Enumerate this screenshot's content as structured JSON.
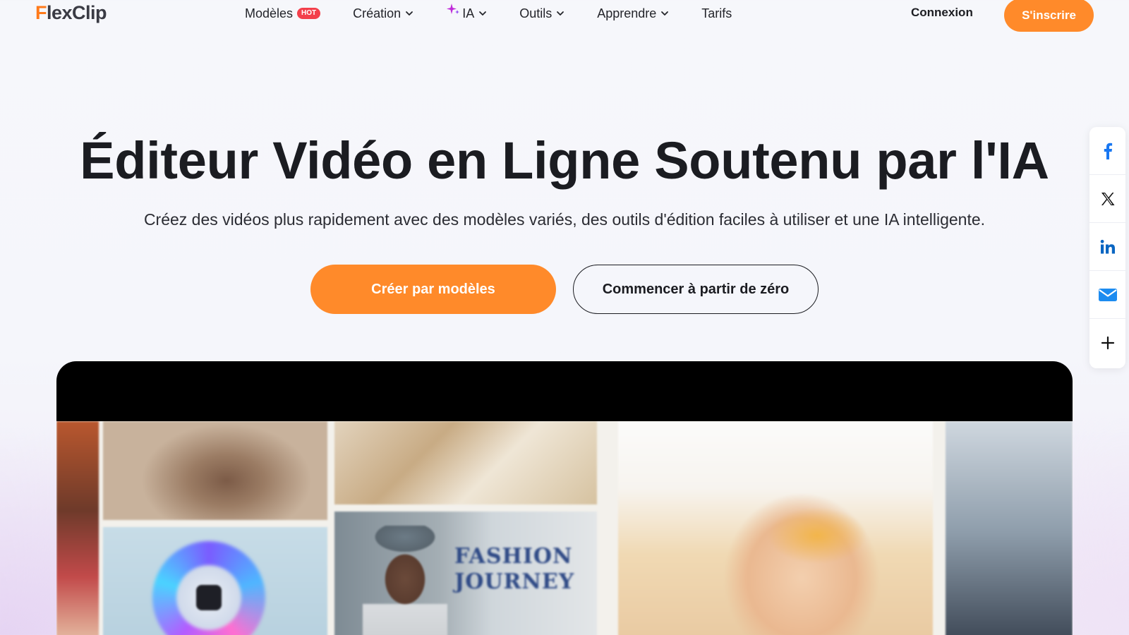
{
  "nav": {
    "logo": {
      "first_letter": "F",
      "rest": "lexClip"
    },
    "items": [
      {
        "label": "Modèles",
        "badge": "HOT",
        "has_chevron": false
      },
      {
        "label": "Création",
        "has_chevron": true
      },
      {
        "label": "IA",
        "icon": "sparkle-icon",
        "has_chevron": true
      },
      {
        "label": "Outils",
        "has_chevron": true
      },
      {
        "label": "Apprendre",
        "has_chevron": true
      },
      {
        "label": "Tarifs",
        "has_chevron": false
      }
    ],
    "login_label": "Connexion",
    "signup_label": "S'inscrire"
  },
  "hero": {
    "title": "Éditeur Vidéo en Ligne Soutenu par l'IA",
    "subtitle": "Créez des vidéos plus rapidement avec des modèles variés, des outils d'édition faciles à utiliser et une IA intelligente.",
    "primary_cta": "Créer par modèles",
    "secondary_cta": "Commencer à partir de zéro"
  },
  "share": {
    "items": [
      "facebook-icon",
      "x-icon",
      "linkedin-icon",
      "email-icon",
      "plus-icon"
    ]
  },
  "preview": {
    "card_text": "FASHION JOURNEY"
  },
  "colors": {
    "accent": "#ff8a2a",
    "hot_badge": "#f33f4b",
    "ia_sparkle": "#c02bd9",
    "facebook": "#1877f2",
    "linkedin": "#0a66c2",
    "email": "#1d8cf0"
  }
}
